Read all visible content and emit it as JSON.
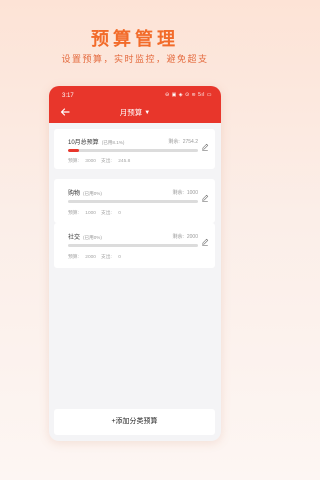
{
  "promo": {
    "title": "预算管理",
    "subtitle": "设置预算，实时监控，避免超支"
  },
  "status_bar": {
    "time": "3:17",
    "icons_text": "⊖ ▣ ◈ ⊙ ≋ 5ıl ▭"
  },
  "appbar": {
    "title": "月预算",
    "back_icon": "arrow-left-icon",
    "dropdown_icon": "caret-down-icon"
  },
  "budgets": [
    {
      "name": "10月总预算",
      "percent_label": "(已用8.1%)",
      "remaining_label": "剩余:",
      "remaining_value": "2754.2",
      "used_fraction": 0.081,
      "budget_label": "预算:",
      "budget_value": "3000",
      "spent_label": "支出:",
      "spent_value": "245.8"
    },
    {
      "name": "购物",
      "percent_label": "(已用0%)",
      "remaining_label": "剩余:",
      "remaining_value": "1000",
      "used_fraction": 0,
      "budget_label": "预算:",
      "budget_value": "1000",
      "spent_label": "支出:",
      "spent_value": "0"
    },
    {
      "name": "社交",
      "percent_label": "(已用0%)",
      "remaining_label": "剩余:",
      "remaining_value": "2000",
      "used_fraction": 0,
      "budget_label": "预算:",
      "budget_value": "2000",
      "spent_label": "支出:",
      "spent_value": "0"
    }
  ],
  "add_button_label": "+添加分类预算",
  "colors": {
    "accent": "#e8362b",
    "promo_title": "#f26b2a",
    "progress_track": "#dcdcdc"
  }
}
